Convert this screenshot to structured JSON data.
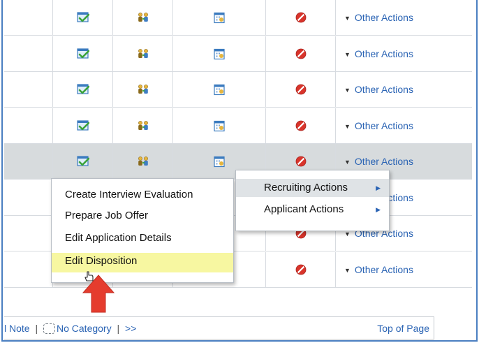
{
  "rows": [
    {
      "action_label": "Other Actions",
      "highlighted": false
    },
    {
      "action_label": "Other Actions",
      "highlighted": false
    },
    {
      "action_label": "Other Actions",
      "highlighted": false
    },
    {
      "action_label": "Other Actions",
      "highlighted": false
    },
    {
      "action_label": "Other Actions",
      "highlighted": true
    },
    {
      "action_label": "Other Actions",
      "highlighted": false
    },
    {
      "action_label": "Other Actions",
      "highlighted": false
    },
    {
      "action_label": "Other Actions",
      "highlighted": false
    }
  ],
  "context_menu": {
    "items": [
      {
        "label": "Create Interview Evaluation"
      },
      {
        "label": "Prepare Job Offer"
      },
      {
        "label": "Edit Application Details"
      },
      {
        "label": "Edit Disposition",
        "selected": true
      }
    ]
  },
  "parent_menu": {
    "items": [
      {
        "label": "Recruiting Actions",
        "active": true
      },
      {
        "label": "Applicant Actions"
      }
    ]
  },
  "footer": {
    "note_link": "l Note",
    "separator": "|",
    "no_category": "No Category",
    "next": ">>",
    "top_of_page": "Top of Page"
  },
  "icons": {
    "approve": "checkmark-window-icon",
    "interview": "people-swap-icon",
    "calendar": "calendar-icon",
    "reject": "no-entry-icon",
    "caret": "caret-down-icon",
    "submenu": "caret-right-icon"
  },
  "colors": {
    "link": "#2b64b4",
    "selected_menu": "#f7f7a1",
    "highlight_row": "#d7dbdd",
    "annotation_arrow": "#e53c2e",
    "reject_icon": "#d9342b"
  }
}
